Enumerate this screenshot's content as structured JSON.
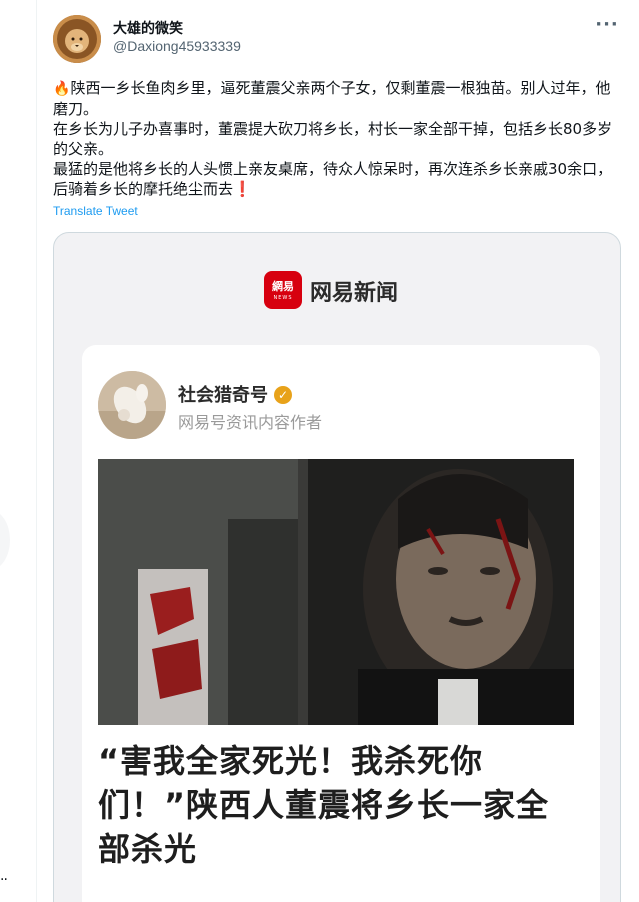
{
  "tweet": {
    "display_name": "大雄的微笑",
    "handle": "@Daxiong45933339",
    "more_label": "···",
    "text": {
      "fire_emoji": "🔥",
      "line1": "陕西一乡长鱼肉乡里，逼死董震父亲两个子女，仅剩董震一根独苗。别人过年，他磨刀。",
      "line2": "在乡长为儿子办喜事时，董震提大砍刀将乡长，村长一家全部干掉，包括乡长80多岁的父亲。",
      "line3": "最猛的是他将乡长的人头惯上亲友桌席，待众人惊呆时，再次连杀乡长亲戚30余口，后骑着乡长的摩托绝尘而去",
      "exclamation_emoji": "❗"
    },
    "translate_label": "Translate Tweet"
  },
  "media": {
    "app_logo_text": "網易",
    "app_logo_subtext": "NEWS",
    "app_name": "网易新闻",
    "author": {
      "name": "社会猎奇号",
      "verified_mark": "✓",
      "description": "网易号资讯内容作者"
    },
    "headline": "“害我全家死光！我杀死你们！”陕西人董震将乡长一家全部杀光"
  },
  "left_rail": {
    "dots": "··"
  },
  "colors": {
    "link": "#1d9bf0",
    "text_primary": "#0f1419",
    "text_secondary": "#536471",
    "netease_red": "#d7000f",
    "verified": "#e8a21a"
  }
}
